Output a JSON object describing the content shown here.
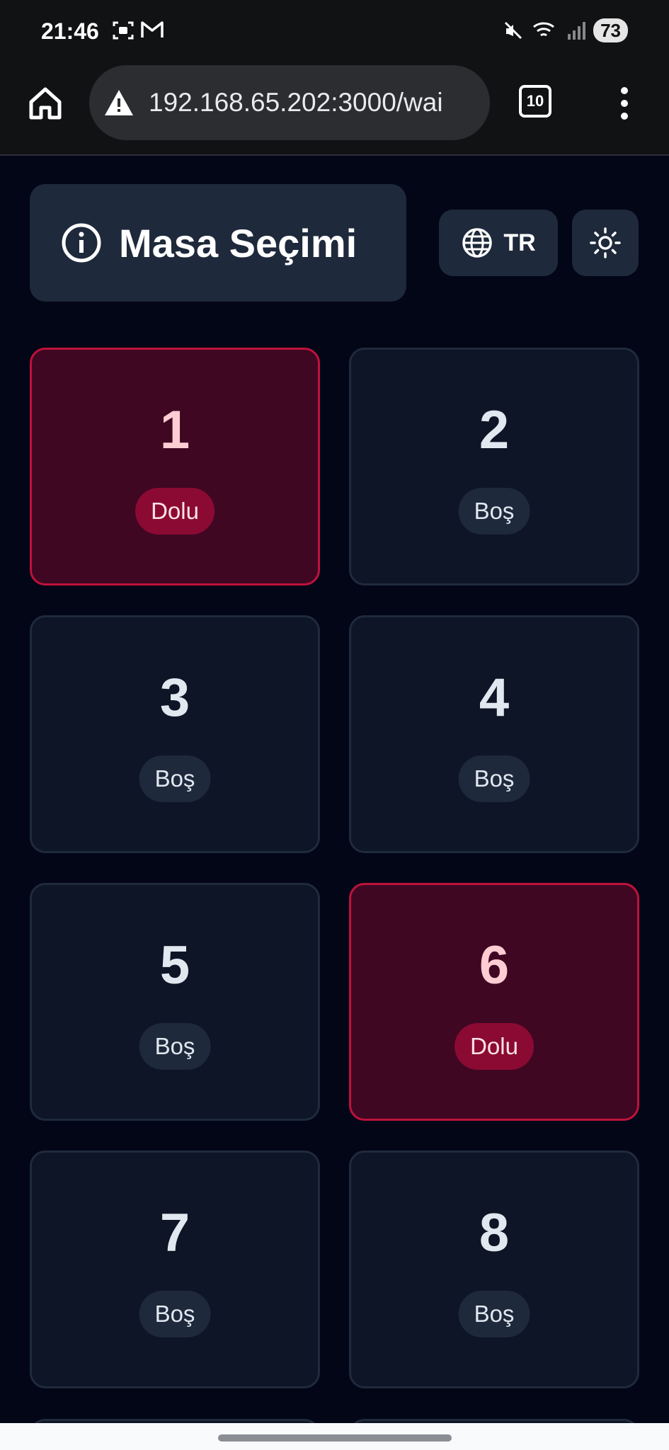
{
  "status_bar": {
    "time": "21:46",
    "battery": "73"
  },
  "browser": {
    "url": "192.168.65.202:3000/wai",
    "tab_count": "10"
  },
  "header": {
    "title": "Masa Seçimi",
    "language": "TR"
  },
  "tables": [
    {
      "number": "1",
      "status": "Dolu",
      "occupied": true
    },
    {
      "number": "2",
      "status": "Boş",
      "occupied": false
    },
    {
      "number": "3",
      "status": "Boş",
      "occupied": false
    },
    {
      "number": "4",
      "status": "Boş",
      "occupied": false
    },
    {
      "number": "5",
      "status": "Boş",
      "occupied": false
    },
    {
      "number": "6",
      "status": "Dolu",
      "occupied": true
    },
    {
      "number": "7",
      "status": "Boş",
      "occupied": false
    },
    {
      "number": "8",
      "status": "Boş",
      "occupied": false
    }
  ],
  "colors": {
    "occupied_border": "#be123c",
    "empty_card": "#0d1526",
    "page_bg": "#030617"
  }
}
